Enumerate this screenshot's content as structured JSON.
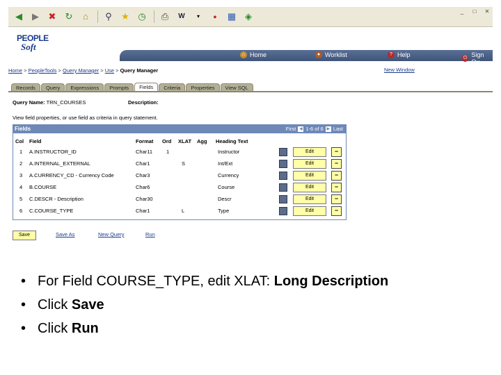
{
  "toolbar": {
    "icons": [
      "back-icon",
      "forward-icon",
      "stop-icon",
      "refresh-icon",
      "home-icon",
      "search-icon",
      "favorites-icon",
      "history-icon",
      "print-icon",
      "edit-icon",
      "messenger-icon",
      "extra1-icon",
      "extra2-icon",
      "extra3-icon"
    ]
  },
  "header": {
    "logo_line1": "PEOPLE",
    "logo_line2": "Soft",
    "nav": {
      "home": "Home",
      "worklist": "Worklist",
      "help": "Help",
      "signout": "Sign Ou"
    }
  },
  "breadcrumb": {
    "items": [
      "Home",
      "PeopleTools",
      "Query Manager",
      "Use"
    ],
    "current": "Query Manager",
    "sep": " > "
  },
  "new_window": "New Window",
  "tabs": [
    "Records",
    "Query",
    "Expressions",
    "Prompts",
    "Fields",
    "Criteria",
    "Properties",
    "View SQL"
  ],
  "active_tab": "Fields",
  "query": {
    "name_label": "Query Name:",
    "name_value": "TRN_COURSES",
    "description_label": "Description:"
  },
  "hint": "View field properties, or use field as criteria in query statement.",
  "grid": {
    "title": "Fields",
    "nav": {
      "first": "First",
      "range": "1-6 of 6",
      "last": "Last"
    },
    "columns": [
      "Col",
      "Field",
      "Format",
      "Ord",
      "XLAT",
      "Agg",
      "Heading Text"
    ],
    "edit_label": "Edit",
    "remove_label": "−",
    "rows": [
      {
        "col": "1",
        "field": "A.INSTRUCTOR_ID",
        "format": "Char11",
        "ord": "1",
        "xlat": "",
        "agg": "",
        "heading": "Instructor"
      },
      {
        "col": "2",
        "field": "A.INTERNAL_EXTERNAL",
        "format": "Char1",
        "ord": "",
        "xlat": "S",
        "agg": "",
        "heading": "Int/Ext"
      },
      {
        "col": "3",
        "field": "A.CURRENCY_CD - Currency Code",
        "format": "Char3",
        "ord": "",
        "xlat": "",
        "agg": "",
        "heading": "Currency"
      },
      {
        "col": "4",
        "field": "B.COURSE",
        "format": "Char6",
        "ord": "",
        "xlat": "",
        "agg": "",
        "heading": "Course"
      },
      {
        "col": "5",
        "field": "C.DESCR - Description",
        "format": "Char30",
        "ord": "",
        "xlat": "",
        "agg": "",
        "heading": "Descr"
      },
      {
        "col": "6",
        "field": "C.COURSE_TYPE",
        "format": "Char1",
        "ord": "",
        "xlat": "L",
        "agg": "",
        "heading": "Type"
      }
    ]
  },
  "actions": {
    "save": "Save",
    "save_as": "Save As",
    "new_query": "New Query",
    "run": "Run"
  },
  "instructions": [
    {
      "prefix": "For Field COURSE_TYPE, edit XLAT: ",
      "bold": "Long Description"
    },
    {
      "prefix": "Click ",
      "bold": "Save"
    },
    {
      "prefix": "Click ",
      "bold": "Run"
    }
  ]
}
